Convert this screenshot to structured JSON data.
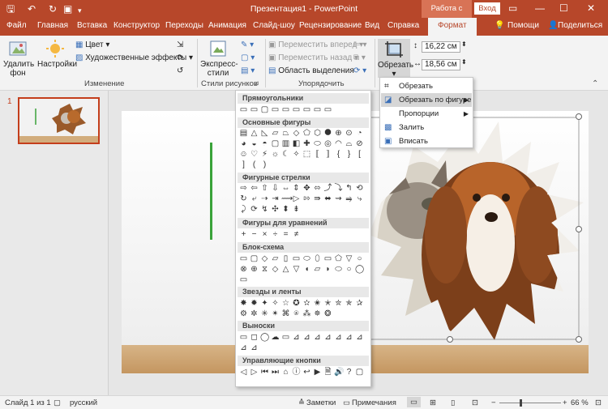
{
  "titlebar": {
    "title": "Презентация1  -  PowerPoint",
    "context_label": "Работа с рис...",
    "login_label": "Вход",
    "quick_access": [
      "save-icon",
      "undo-icon",
      "redo-icon",
      "slideshow-icon",
      "customize-icon"
    ]
  },
  "tabs": {
    "items": [
      "Файл",
      "Главная",
      "Вставка",
      "Конструктор",
      "Переходы",
      "Анимация",
      "Слайд-шоу",
      "Рецензирование",
      "Вид",
      "Справка",
      "Формат"
    ],
    "active": "Формат",
    "help": "Помощи",
    "share": "Поделиться"
  },
  "ribbon": {
    "remove_bg": "Удалить фон",
    "settings": "Настройки",
    "color": "Цвет",
    "art_effects": "Художественные эффекты",
    "group_change": "Изменение",
    "express_styles": "Экспресс-стили",
    "group_styles": "Стили рисунков",
    "bring_forward": "Переместить вперед",
    "send_backward": "Переместить назад",
    "selection_pane": "Область выделения",
    "group_arrange": "Упорядочить",
    "crop": "Обрезать",
    "height": "16,22 см",
    "width": "18,56 см"
  },
  "slide_panel": {
    "slide_number": "1"
  },
  "crop_menu": {
    "items": [
      {
        "label": "Обрезать",
        "icon": "crop-icon",
        "submenu": false
      },
      {
        "label": "Обрезать по фигуре",
        "icon": "crop-shape-icon",
        "submenu": true
      },
      {
        "label": "Пропорции",
        "icon": "",
        "submenu": true
      },
      {
        "label": "Залить",
        "icon": "fill-icon",
        "submenu": false
      },
      {
        "label": "Вписать",
        "icon": "fit-icon",
        "submenu": false
      }
    ]
  },
  "gallery": {
    "sections": [
      {
        "title": "Прямоугольники",
        "shapes": [
          "▭",
          "▭",
          "▢",
          "▭",
          "▭",
          "▭",
          "▭",
          "▭",
          "▭"
        ]
      },
      {
        "title": "Основные фигуры",
        "shapes": [
          "▤",
          "△",
          "◺",
          "▱",
          "⏢",
          "◇",
          "⬠",
          "⬡",
          "⯃",
          "⊕",
          "⊙",
          "◔",
          "◕",
          "◒",
          "◓",
          "▢",
          "▥",
          "◧",
          "✚",
          "⬭",
          "◎",
          "◠",
          "⌓",
          "⊘",
          "☺",
          "♡",
          "⚡",
          "☼",
          "☾",
          "✧",
          "⬚",
          "⟦",
          "⟧",
          "{",
          "}",
          "[",
          "]",
          "(",
          ")"
        ]
      },
      {
        "title": "Фигурные стрелки",
        "shapes": [
          "⇨",
          "⇦",
          "⇧",
          "⇩",
          "⇔",
          "⇕",
          "✥",
          "⬄",
          "⤴",
          "⤵",
          "↰",
          "⟲",
          "↻",
          "⤶",
          "⇢",
          "⇥",
          "⟿",
          "▷",
          "⇰",
          "⇛",
          "⬌",
          "⇝",
          "⥤",
          "⤷",
          "⤸",
          "⟳",
          "↯",
          "✣",
          "⬍",
          "⇟"
        ]
      },
      {
        "title": "Фигуры для уравнений",
        "shapes": [
          "+",
          "−",
          "×",
          "÷",
          "=",
          "≠"
        ]
      },
      {
        "title": "Блок-схема",
        "shapes": [
          "▭",
          "▢",
          "◇",
          "▱",
          "▯",
          "▭",
          "⬭",
          "⬯",
          "▭",
          "⬠",
          "▽",
          "○",
          "⊗",
          "⊕",
          "⧖",
          "◇",
          "△",
          "▽",
          "◖",
          "▱",
          "◗",
          "⬭",
          "○",
          "◯",
          "▭"
        ]
      },
      {
        "title": "Звезды и ленты",
        "shapes": [
          "✸",
          "✹",
          "✦",
          "✧",
          "☆",
          "✪",
          "✫",
          "✬",
          "✭",
          "✮",
          "✯",
          "✰",
          "⚙",
          "✲",
          "✳",
          "✴",
          "⌘",
          "⍟",
          "⁂",
          "✵",
          "❂"
        ]
      },
      {
        "title": "Выноски",
        "shapes": [
          "▭",
          "◻",
          "◯",
          "☁",
          "▭",
          "⊿",
          "⊿",
          "⊿",
          "⊿",
          "⊿",
          "⊿",
          "⊿",
          "⊿",
          "⊿"
        ]
      },
      {
        "title": "Управляющие кнопки",
        "shapes": [
          "◁",
          "▷",
          "⏮",
          "⏭",
          "⌂",
          "ⓘ",
          "↩",
          "▶",
          "🗎",
          "🔊",
          "?",
          "▢"
        ]
      }
    ]
  },
  "status": {
    "slide_info": "Слайд 1 из 1",
    "language": "русский",
    "notes": "Заметки",
    "comments": "Примечания",
    "zoom": "66 %"
  }
}
